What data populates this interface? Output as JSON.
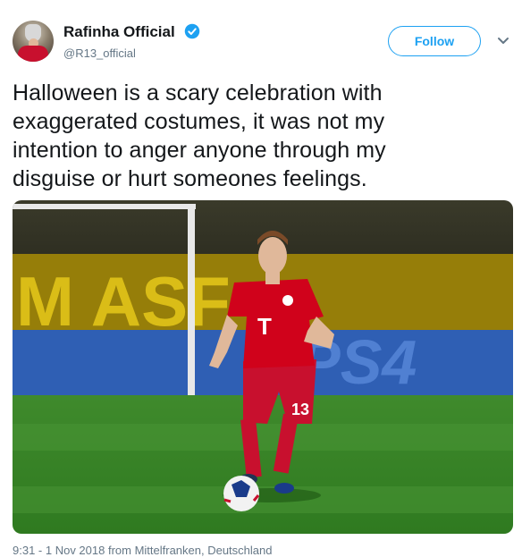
{
  "author": {
    "display_name": "Rafinha Official",
    "handle": "@R13_official",
    "verified": true,
    "avatar_icon": "avatar-photo"
  },
  "follow_button": {
    "label": "Follow"
  },
  "menu": {
    "icon": "chevron-down-icon"
  },
  "tweet": {
    "text": "Halloween is a scary celebration with\nexaggerated costumes, it was not my\nintention to anger anyone through my\ndisguise or hurt someones feelings."
  },
  "media": {
    "description_icon": "football-photo",
    "jersey_number": "13",
    "sponsor_mark": "T"
  },
  "meta": {
    "timestamp_partial": "9:31 - 1 Nov 2018 from Mittelfranken, Deutschland"
  },
  "colors": {
    "accent": "#1da1f2",
    "text": "#14171a",
    "secondary_text": "#657786",
    "jersey_red": "#d0021b"
  }
}
